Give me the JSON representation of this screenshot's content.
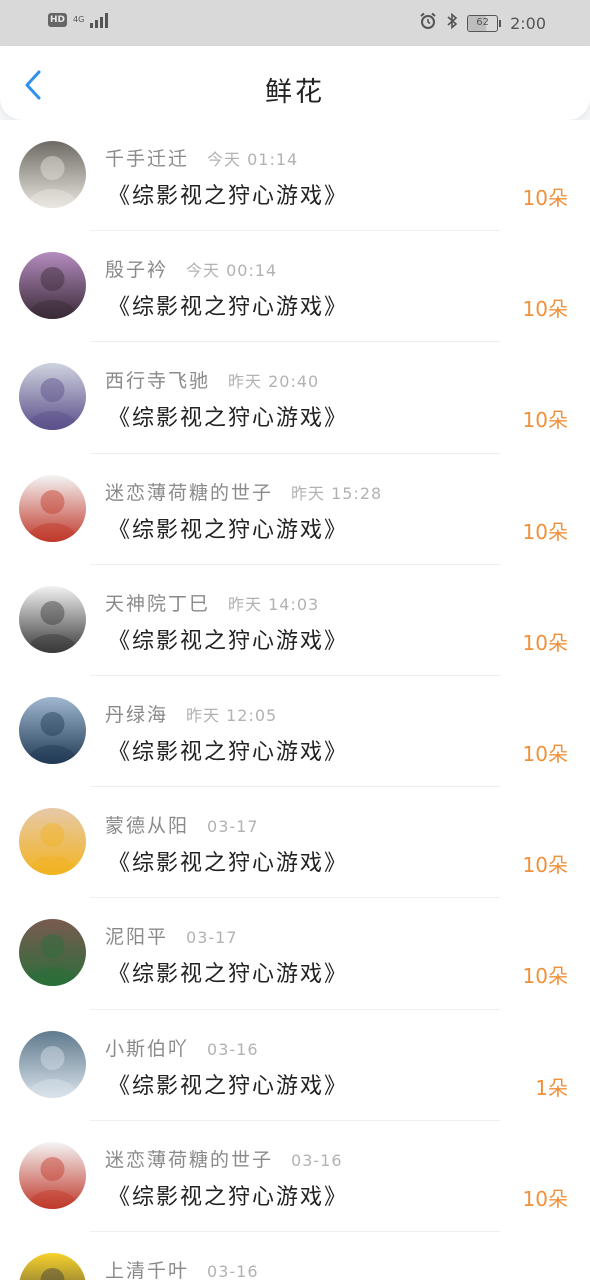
{
  "status_bar": {
    "hd": "HD",
    "network": "4G",
    "battery": "62",
    "battery_level": 0.62,
    "time": "2:00",
    "icons": [
      "signal-icon",
      "alarm-icon",
      "bluetooth-icon",
      "battery-icon"
    ]
  },
  "header": {
    "title": "鲜花",
    "back_icon": "chevron-left-icon",
    "accent": "#2f8ff0"
  },
  "colors": {
    "count": "#f0913a",
    "name": "#8a8a8a",
    "time": "#b2b2b2"
  },
  "records": [
    {
      "name": "千手迁迁",
      "time": "今天 01:14",
      "book": "《综影视之狩心游戏》",
      "count": "10朵",
      "avatar": "husky-dog",
      "avatar_colors": [
        "#6f6a64",
        "#e9e6e0"
      ]
    },
    {
      "name": "殷子衿",
      "time": "今天 00:14",
      "book": "《综影视之狩心游戏》",
      "count": "10朵",
      "avatar": "woman-purple-dress",
      "avatar_colors": [
        "#b48cc0",
        "#3a2a36"
      ]
    },
    {
      "name": "西行寺飞驰",
      "time": "昨天 20:40",
      "book": "《综影视之狩心游戏》",
      "count": "10朵",
      "avatar": "anime-silver-hair",
      "avatar_colors": [
        "#cfd3df",
        "#5b4f8a"
      ]
    },
    {
      "name": "迷恋薄荷糖的世子",
      "time": "昨天 15:28",
      "book": "《综影视之狩心游戏》",
      "count": "10朵",
      "avatar": "cartoon-couple",
      "avatar_colors": [
        "#f4f4f4",
        "#c0392b"
      ]
    },
    {
      "name": "天神院丁巳",
      "time": "昨天 14:03",
      "book": "《综影视之狩心游戏》",
      "count": "10朵",
      "avatar": "man-portrait-bw",
      "avatar_colors": [
        "#f2f2f2",
        "#3a3a3a"
      ]
    },
    {
      "name": "丹绿海",
      "time": "昨天 12:05",
      "book": "《综影视之狩心游戏》",
      "count": "10朵",
      "avatar": "girl-by-sea",
      "avatar_colors": [
        "#9fb8d0",
        "#223a55"
      ]
    },
    {
      "name": "蒙德从阳",
      "time": "03-17",
      "book": "《综影视之狩心游戏》",
      "count": "10朵",
      "avatar": "cupcakes",
      "avatar_colors": [
        "#e6c9a8",
        "#f2b321"
      ]
    },
    {
      "name": "泥阳平",
      "time": "03-17",
      "book": "《综影视之狩心游戏》",
      "count": "10朵",
      "avatar": "girl-long-hair",
      "avatar_colors": [
        "#7a5a50",
        "#2a6e3a"
      ]
    },
    {
      "name": "小斯伯吖",
      "time": "03-16",
      "book": "《综影视之狩心游戏》",
      "count": "1朵",
      "avatar": "elf-portrait",
      "avatar_colors": [
        "#5f7a8e",
        "#d9e2ea"
      ]
    },
    {
      "name": "迷恋薄荷糖的世子",
      "time": "03-16",
      "book": "《综影视之狩心游戏》",
      "count": "10朵",
      "avatar": "cartoon-couple",
      "avatar_colors": [
        "#f4f4f4",
        "#c0392b"
      ]
    },
    {
      "name": "上清千叶",
      "time": "03-16",
      "book": "",
      "count": "",
      "avatar": "minion",
      "avatar_colors": [
        "#f7d22b",
        "#3b3b3b"
      ]
    }
  ]
}
